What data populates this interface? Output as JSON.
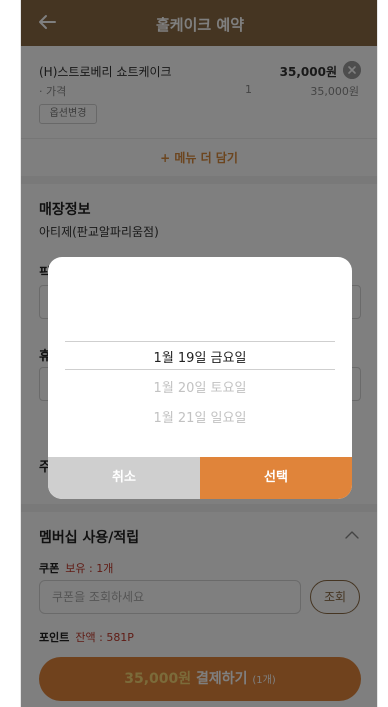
{
  "header": {
    "title": "홀케이크 예약"
  },
  "product": {
    "name": "(H)스트로베리 쇼트케이크",
    "price": "35,000원",
    "sub_label": "· 가격",
    "quantity": "1",
    "sub_price": "35,000원",
    "option_button": "옵션변경"
  },
  "more_menu": "+ 메뉴 더 담기",
  "store": {
    "title": "매장정보",
    "name": "아티제(판교알파리움점)"
  },
  "form": {
    "pickup_label": "픽",
    "phone_label": "휴",
    "order_label": "주"
  },
  "date_picker": {
    "selected": "1월 19일 금요일",
    "options": [
      "1월 20일 토요일",
      "1월 21일 일요일"
    ],
    "cancel_label": "취소",
    "confirm_label": "선택"
  },
  "membership": {
    "title": "멤버십 사용/적립",
    "coupon_label": "쿠폰",
    "coupon_value": "보유 : 1개",
    "coupon_placeholder": "쿠폰을 조회하세요",
    "coupon_button": "조회",
    "point_label": "포인트",
    "point_value": "잔액 : 581P"
  },
  "payment": {
    "amount": "35,000원",
    "label": "결제하기",
    "count": "(1개)"
  },
  "colors": {
    "header": "#8a6a45",
    "accent": "#e0843a",
    "highlight": "#c0392b"
  }
}
